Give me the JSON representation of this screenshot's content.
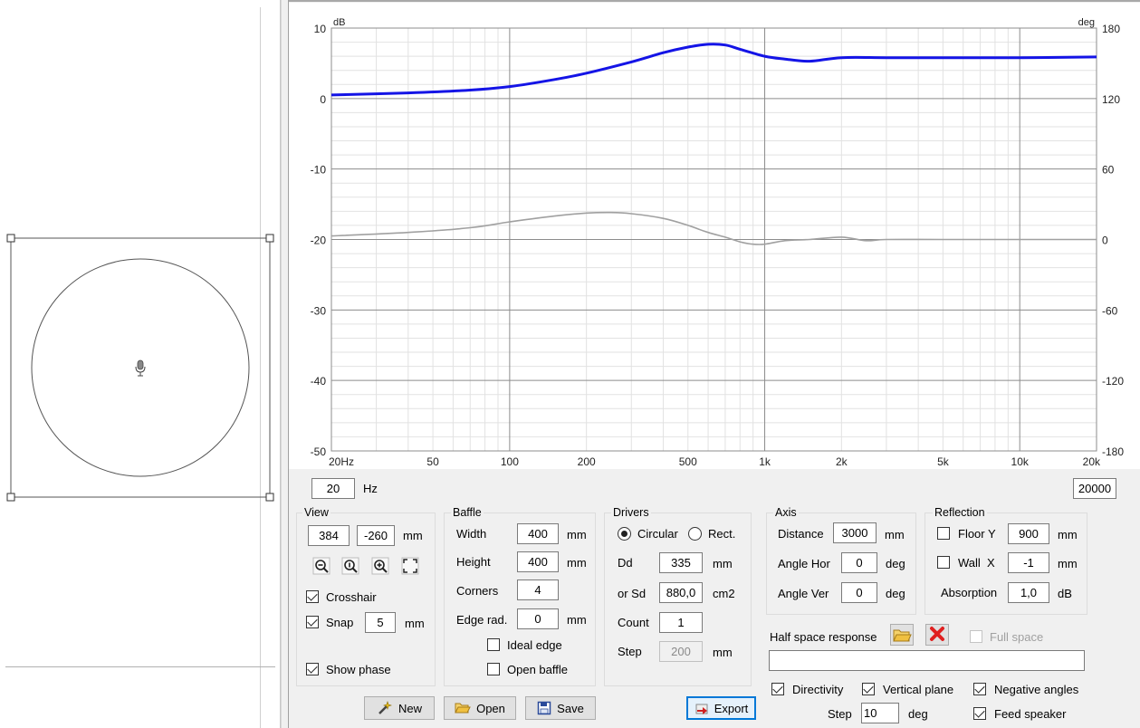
{
  "chart_data": {
    "type": "line",
    "x_scale": "log",
    "xlim": [
      20,
      20000
    ],
    "ylim": [
      -50,
      10
    ],
    "y2lim": [
      -180,
      180
    ],
    "ylabel": "dB",
    "y2label": "deg",
    "x_ticks": [
      {
        "v": 20,
        "t": "20Hz"
      },
      {
        "v": 50,
        "t": "50"
      },
      {
        "v": 100,
        "t": "100"
      },
      {
        "v": 200,
        "t": "200"
      },
      {
        "v": 500,
        "t": "500"
      },
      {
        "v": 1000,
        "t": "1k"
      },
      {
        "v": 2000,
        "t": "2k"
      },
      {
        "v": 5000,
        "t": "5k"
      },
      {
        "v": 10000,
        "t": "10k"
      },
      {
        "v": 20000,
        "t": "20k"
      }
    ],
    "y_ticks": [
      10,
      0,
      -10,
      -20,
      -30,
      -40,
      -50
    ],
    "y2_ticks": [
      180,
      120,
      60,
      0,
      -60,
      -120,
      -180
    ],
    "grid": true,
    "series": [
      {
        "color": "#1414e6",
        "axis": "left",
        "x": [
          20,
          40,
          70,
          100,
          150,
          200,
          300,
          400,
          500,
          600,
          700,
          800,
          1000,
          1200,
          1500,
          2000,
          3000,
          5000,
          10000,
          20000
        ],
        "y": [
          0.5,
          0.8,
          1.2,
          1.7,
          2.7,
          3.6,
          5.2,
          6.5,
          7.3,
          7.7,
          7.6,
          7.0,
          6.0,
          5.6,
          5.3,
          5.8,
          5.8,
          5.8,
          5.8,
          5.9
        ]
      },
      {
        "color": "#a0a0a0",
        "axis": "right",
        "x": [
          20,
          40,
          70,
          100,
          150,
          200,
          250,
          300,
          400,
          500,
          600,
          700,
          800,
          900,
          1000,
          1200,
          1500,
          2000,
          2500,
          3000,
          5000,
          10000,
          20000
        ],
        "y": [
          3,
          6,
          10,
          15,
          20,
          22.5,
          23,
          22,
          18,
          12,
          6,
          2,
          -2,
          -4,
          -4,
          -1,
          0,
          2,
          -1,
          0,
          0,
          0,
          0
        ]
      }
    ]
  },
  "freq": {
    "min": "20",
    "unit": "Hz",
    "max": "20000"
  },
  "view": {
    "title": "View",
    "x": "384",
    "y": "-260",
    "unit": "mm",
    "crosshair_label": "Crosshair",
    "snap_label": "Snap",
    "snap_value": "5",
    "snap_unit": "mm",
    "show_phase_label": "Show phase"
  },
  "baffle": {
    "title": "Baffle",
    "width_label": "Width",
    "width": "400",
    "width_unit": "mm",
    "height_label": "Height",
    "height": "400",
    "height_unit": "mm",
    "corners_label": "Corners",
    "corners": "4",
    "edge_label": "Edge rad.",
    "edge": "0",
    "edge_unit": "mm",
    "ideal_edge_label": "Ideal edge",
    "open_baffle_label": "Open baffle"
  },
  "drivers": {
    "title": "Drivers",
    "circular_label": "Circular",
    "rect_label": "Rect.",
    "dd_label": "Dd",
    "dd": "335",
    "dd_unit": "mm",
    "sd_label": "or Sd",
    "sd": "880,0",
    "sd_unit": "cm2",
    "count_label": "Count",
    "count": "1",
    "step_label": "Step",
    "step": "200",
    "step_unit": "mm"
  },
  "axis": {
    "title": "Axis",
    "distance_label": "Distance",
    "distance": "3000",
    "distance_unit": "mm",
    "hor_label": "Angle Hor",
    "hor": "0",
    "hor_unit": "deg",
    "ver_label": "Angle Ver",
    "ver": "0",
    "ver_unit": "deg"
  },
  "reflection": {
    "title": "Reflection",
    "floor_label": "Floor Y",
    "floor": "900",
    "floor_unit": "mm",
    "wall_label": "Wall  X",
    "wall": "-1",
    "wall_unit": "mm",
    "absorption_label": "Absorption",
    "absorption": "1,0",
    "absorption_unit": "dB"
  },
  "half_space": {
    "label": "Half space response",
    "full_space_label": "Full space",
    "path": ""
  },
  "directivity": {
    "directivity_label": "Directivity",
    "vertical_plane_label": "Vertical plane",
    "negative_angles_label": "Negative angles",
    "step_label": "Step",
    "step": "10",
    "step_unit": "deg",
    "feed_speaker_label": "Feed speaker"
  },
  "buttons": {
    "new": "New",
    "open": "Open",
    "save": "Save",
    "export": "Export"
  },
  "colors": {
    "blue_trace": "#1414e6",
    "gray_trace": "#a0a0a0",
    "focus": "#0078d7",
    "delete_icon": "#e02020",
    "folder_icon": "#f0c040"
  }
}
